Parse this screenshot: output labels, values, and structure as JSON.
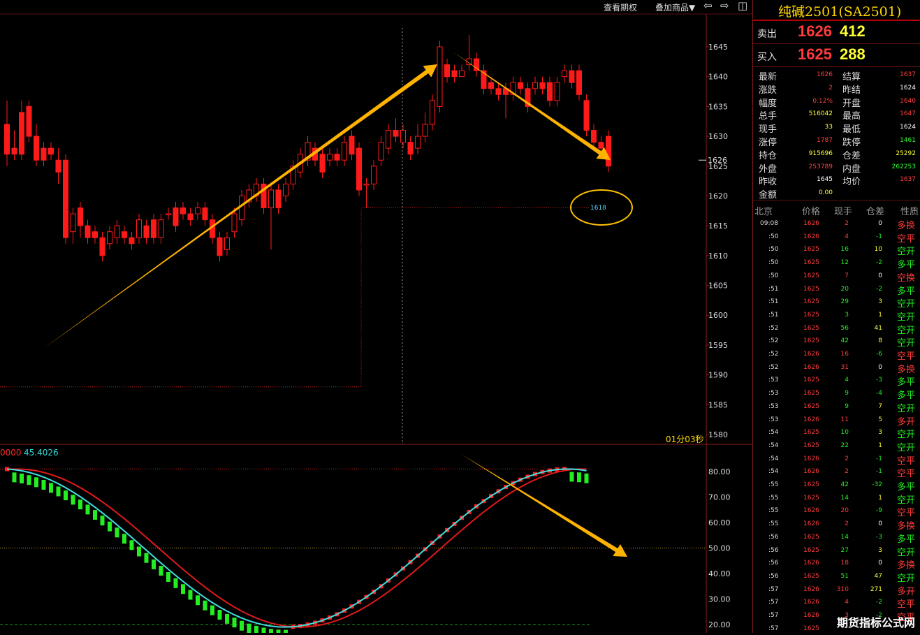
{
  "toolbar": {
    "view_options": "查看期权",
    "overlay": "叠加商品▼",
    "left_arrow": "⇦",
    "right_arrow": "⇨",
    "panel": "◫"
  },
  "chart": {
    "price_axis": [
      "1645",
      "1640",
      "1635",
      "1630",
      "1625",
      "1620",
      "1615",
      "1610",
      "1605",
      "1600",
      "1595",
      "1590",
      "1585",
      "1580"
    ],
    "current_price_tag": "1626",
    "level_label": "1618",
    "countdown": "01分03秒",
    "indicator_label_a": "0000",
    "indicator_label_b": "45.4026",
    "indicator_axis": [
      "80.00",
      "70.00",
      "60.00",
      "50.00",
      "40.00",
      "30.00",
      "20.00"
    ]
  },
  "chart_data": {
    "type": "candlestick",
    "ylim": [
      1578,
      1648
    ],
    "candles": [
      [
        1632,
        1627,
        1636,
        1625
      ],
      [
        1628,
        1627,
        1631,
        1626
      ],
      [
        1634,
        1627,
        1636,
        1626
      ],
      [
        1635,
        1630,
        1636,
        1629
      ],
      [
        1630,
        1626,
        1632,
        1625
      ],
      [
        1628,
        1626,
        1629,
        1625
      ],
      [
        1628,
        1627,
        1629,
        1626
      ],
      [
        1626,
        1624,
        1628,
        1622
      ],
      [
        1626,
        1613,
        1627,
        1612
      ],
      [
        1614,
        1617,
        1618,
        1612
      ],
      [
        1618,
        1615,
        1619,
        1613
      ],
      [
        1615,
        1613,
        1616,
        1612
      ],
      [
        1614,
        1613,
        1615,
        1612
      ],
      [
        1613,
        1610,
        1614,
        1609
      ],
      [
        1612,
        1614,
        1615,
        1611
      ],
      [
        1613,
        1615,
        1616,
        1612
      ],
      [
        1614,
        1613,
        1615,
        1612
      ],
      [
        1613,
        1612,
        1614,
        1611
      ],
      [
        1613,
        1616,
        1617,
        1612
      ],
      [
        1615,
        1613,
        1616,
        1612
      ],
      [
        1616,
        1613,
        1617,
        1612
      ],
      [
        1613,
        1616,
        1617,
        1612
      ],
      [
        1617,
        1617,
        1618,
        1616
      ],
      [
        1618,
        1615,
        1619,
        1614
      ],
      [
        1618,
        1617,
        1619,
        1616
      ],
      [
        1617,
        1616,
        1618,
        1615
      ],
      [
        1617,
        1618,
        1619,
        1616
      ],
      [
        1618,
        1616,
        1619,
        1615
      ],
      [
        1616,
        1613,
        1617,
        1612
      ],
      [
        1613,
        1610,
        1614,
        1609
      ],
      [
        1611,
        1613,
        1614,
        1610
      ],
      [
        1614,
        1617,
        1618,
        1613
      ],
      [
        1616,
        1620,
        1621,
        1615
      ],
      [
        1619,
        1621,
        1622,
        1618
      ],
      [
        1620,
        1622,
        1623,
        1619
      ],
      [
        1622,
        1618,
        1623,
        1617
      ],
      [
        1618,
        1621,
        1622,
        1611
      ],
      [
        1621,
        1618,
        1622,
        1617
      ],
      [
        1620,
        1622,
        1623,
        1619
      ],
      [
        1622,
        1625,
        1626,
        1621
      ],
      [
        1624,
        1627,
        1628,
        1623
      ],
      [
        1626,
        1629,
        1630,
        1625
      ],
      [
        1628,
        1626,
        1629,
        1625
      ],
      [
        1627,
        1624,
        1628,
        1623
      ],
      [
        1626,
        1627,
        1628,
        1625
      ],
      [
        1627,
        1626,
        1628,
        1625
      ],
      [
        1626,
        1629,
        1630,
        1625
      ],
      [
        1630,
        1627,
        1631,
        1626
      ],
      [
        1628,
        1621,
        1629,
        1620
      ],
      [
        1622,
        1622,
        1623,
        1618
      ],
      [
        1622,
        1625,
        1626,
        1621
      ],
      [
        1626,
        1629,
        1630,
        1625
      ],
      [
        1628,
        1631,
        1632,
        1627
      ],
      [
        1631,
        1630,
        1633,
        1629
      ],
      [
        1629,
        1631,
        1632,
        1628
      ],
      [
        1629,
        1627,
        1630,
        1626
      ],
      [
        1628,
        1630,
        1632,
        1627
      ],
      [
        1630,
        1632,
        1634,
        1629
      ],
      [
        1632,
        1636,
        1637,
        1631
      ],
      [
        1635,
        1645,
        1646,
        1634
      ],
      [
        1642,
        1640,
        1643,
        1639
      ],
      [
        1641,
        1640,
        1642,
        1639
      ],
      [
        1640,
        1641,
        1642,
        1640
      ],
      [
        1642,
        1643,
        1647,
        1641
      ],
      [
        1643,
        1641,
        1644,
        1640
      ],
      [
        1641,
        1638,
        1642,
        1637
      ],
      [
        1639,
        1638,
        1640,
        1637
      ],
      [
        1638,
        1637,
        1639,
        1636
      ],
      [
        1638,
        1637,
        1639,
        1633
      ],
      [
        1637,
        1639,
        1640,
        1636
      ],
      [
        1639,
        1638,
        1640,
        1637
      ],
      [
        1638,
        1635,
        1639,
        1634
      ],
      [
        1638,
        1639,
        1640,
        1637
      ],
      [
        1639,
        1638,
        1640,
        1637
      ],
      [
        1639,
        1636,
        1640,
        1635
      ],
      [
        1636,
        1639,
        1640,
        1635
      ],
      [
        1640,
        1641,
        1642,
        1639
      ],
      [
        1641,
        1639,
        1642,
        1638
      ],
      [
        1641,
        1637,
        1642,
        1636
      ],
      [
        1636,
        1631,
        1637,
        1630
      ],
      [
        1631,
        1629,
        1632,
        1628
      ],
      [
        1629,
        1628,
        1630,
        1627
      ],
      [
        1630,
        1625,
        1631,
        1624
      ]
    ],
    "level": 1618,
    "indicator": {
      "ylim": [
        18,
        88
      ],
      "ref_lines": [
        81,
        50,
        20
      ]
    }
  },
  "panel": {
    "title": "纯碱2501(SA2501)",
    "sell": {
      "label": "卖出",
      "price": "1626",
      "volume": "412"
    },
    "buy": {
      "label": "买入",
      "price": "1625",
      "volume": "288"
    },
    "stats": [
      {
        "l": "最新",
        "v": "1626",
        "c": "#ff4040",
        "l2": "结算",
        "v2": "1637",
        "c2": "#ff4040"
      },
      {
        "l": "涨跌",
        "v": "2",
        "c": "#ff4040",
        "l2": "昨结",
        "v2": "1624",
        "c2": "#ffffff"
      },
      {
        "l": "幅度",
        "v": "0.12%",
        "c": "#ff4040",
        "l2": "开盘",
        "v2": "1640",
        "c2": "#ff4040"
      },
      {
        "l": "总手",
        "v": "516042",
        "c": "#ffff33",
        "l2": "最高",
        "v2": "1647",
        "c2": "#ff4040"
      },
      {
        "l": "现手",
        "v": "33",
        "c": "#ffff33",
        "l2": "最低",
        "v2": "1624",
        "c2": "#ffffff"
      },
      {
        "l": "涨停",
        "v": "1787",
        "c": "#ff4040",
        "l2": "跌停",
        "v2": "1461",
        "c2": "#33ff33"
      },
      {
        "l": "持仓",
        "v": "915696",
        "c": "#ffff33",
        "l2": "仓差",
        "v2": "25292",
        "c2": "#ffff33"
      },
      {
        "l": "外盘",
        "v": "253789",
        "c": "#ff4040",
        "l2": "内盘",
        "v2": "262253",
        "c2": "#33ff33"
      },
      {
        "l": "昨收",
        "v": "1645",
        "c": "#ffffff",
        "l2": "均价",
        "v2": "1637",
        "c2": "#ff4040"
      },
      {
        "l": "金额",
        "v": "0.00",
        "c": "#ffff33",
        "l2": "",
        "v2": "",
        "c2": "#ffffff"
      }
    ],
    "table_headers": [
      "北京",
      "价格",
      "现手",
      "仓差",
      "性质"
    ],
    "ticks": [
      [
        "09:08",
        "1626",
        "2",
        "0",
        "多换"
      ],
      [
        ":50",
        "1626",
        "4",
        "-1",
        "空平"
      ],
      [
        ":50",
        "1625",
        "16",
        "10",
        "空开"
      ],
      [
        ":50",
        "1625",
        "12",
        "-2",
        "多平"
      ],
      [
        ":50",
        "1625",
        "7",
        "0",
        "空换"
      ],
      [
        ":51",
        "1625",
        "20",
        "-2",
        "多平"
      ],
      [
        ":51",
        "1625",
        "29",
        "3",
        "空开"
      ],
      [
        ":51",
        "1625",
        "3",
        "1",
        "空开"
      ],
      [
        ":52",
        "1625",
        "56",
        "41",
        "空开"
      ],
      [
        ":52",
        "1625",
        "42",
        "8",
        "空开"
      ],
      [
        ":52",
        "1626",
        "16",
        "-6",
        "空平"
      ],
      [
        ":52",
        "1626",
        "31",
        "0",
        "多换"
      ],
      [
        ":53",
        "1625",
        "4",
        "-3",
        "多平"
      ],
      [
        ":53",
        "1625",
        "9",
        "-4",
        "多平"
      ],
      [
        ":53",
        "1625",
        "9",
        "7",
        "空开"
      ],
      [
        ":53",
        "1626",
        "11",
        "5",
        "多开"
      ],
      [
        ":54",
        "1625",
        "10",
        "3",
        "空开"
      ],
      [
        ":54",
        "1625",
        "22",
        "1",
        "空开"
      ],
      [
        ":54",
        "1626",
        "2",
        "-1",
        "空平"
      ],
      [
        ":54",
        "1626",
        "2",
        "-1",
        "空平"
      ],
      [
        ":55",
        "1625",
        "42",
        "-32",
        "多平"
      ],
      [
        ":55",
        "1625",
        "14",
        "1",
        "空开"
      ],
      [
        ":55",
        "1626",
        "20",
        "-9",
        "空平"
      ],
      [
        ":55",
        "1626",
        "2",
        "0",
        "多换"
      ],
      [
        ":56",
        "1625",
        "14",
        "-3",
        "多平"
      ],
      [
        ":56",
        "1625",
        "27",
        "3",
        "空开"
      ],
      [
        ":56",
        "1626",
        "18",
        "0",
        "多换"
      ],
      [
        ":56",
        "1625",
        "51",
        "47",
        "空开"
      ],
      [
        ":57",
        "1626",
        "310",
        "271",
        "多开"
      ],
      [
        ":57",
        "1626",
        "4",
        "-2",
        "空平"
      ],
      [
        ":57",
        "1626",
        "3",
        "-2",
        "空平"
      ],
      [
        ":57",
        "1625",
        "",
        "",
        ""
      ]
    ],
    "watermark": "期货指标公式网"
  }
}
